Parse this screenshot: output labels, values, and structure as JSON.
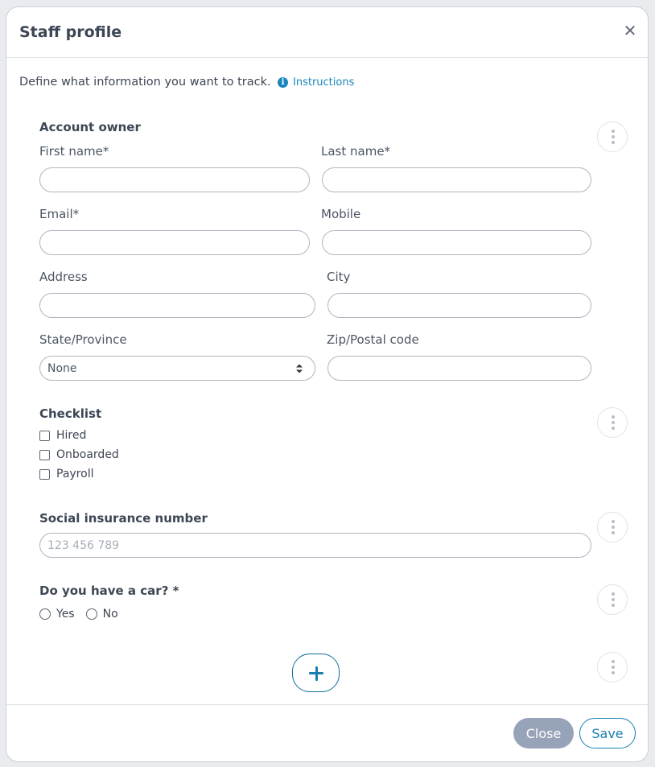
{
  "modal": {
    "title": "Staff profile"
  },
  "intro": {
    "text": "Define what information you want to track.",
    "instructions_link": "Instructions"
  },
  "account_owner": {
    "title": "Account owner",
    "first_name": {
      "label": "First name*",
      "value": ""
    },
    "last_name": {
      "label": "Last name*",
      "value": ""
    },
    "email": {
      "label": "Email*",
      "value": ""
    },
    "mobile": {
      "label": "Mobile",
      "value": ""
    },
    "address": {
      "label": "Address",
      "value": ""
    },
    "city": {
      "label": "City",
      "value": ""
    },
    "state": {
      "label": "State/Province",
      "selected": "None"
    },
    "zip": {
      "label": "Zip/Postal code",
      "value": ""
    }
  },
  "checklist": {
    "title": "Checklist",
    "items": [
      {
        "label": "Hired",
        "checked": false
      },
      {
        "label": "Onboarded",
        "checked": false
      },
      {
        "label": "Payroll",
        "checked": false
      }
    ]
  },
  "sin": {
    "title": "Social insurance number",
    "placeholder": "123 456 789"
  },
  "car": {
    "title": "Do you have a car? *",
    "options": [
      "Yes",
      "No"
    ]
  },
  "footer": {
    "close_label": "Close",
    "save_label": "Save"
  },
  "colors": {
    "accent": "#1a7fb0",
    "close_button": "#97a3b8",
    "link": "#1a86bd"
  },
  "icons": {
    "close": "close-icon",
    "info": "info-icon",
    "menu": "kebab-menu-icon",
    "add": "plus-icon",
    "select": "select-arrows-icon"
  }
}
